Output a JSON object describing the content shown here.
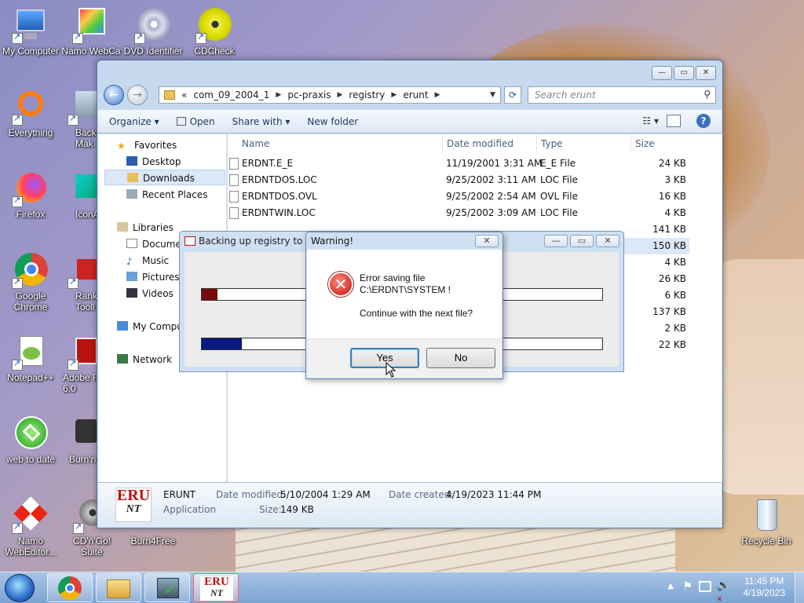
{
  "desktop": {
    "icons": [
      {
        "label": "My Computer"
      },
      {
        "label": "Namo WebCa"
      },
      {
        "label": "DVD Identifier"
      },
      {
        "label": "CDCheck"
      },
      {
        "label": "Everything"
      },
      {
        "label": "Back Mak"
      },
      {
        "label": "Firefox"
      },
      {
        "label": "IconA"
      },
      {
        "label": "Google Chrome"
      },
      {
        "label": "Rank Tooll"
      },
      {
        "label": "Notepad++"
      },
      {
        "label": "Adobe F 6.0"
      },
      {
        "label": "web to date"
      },
      {
        "label": "Burn'n"
      },
      {
        "label": "Namo WebEditor..."
      },
      {
        "label": "CD'n'Go! Suite"
      },
      {
        "label": "Burn4Free"
      },
      {
        "label": "Recycle Bin"
      }
    ]
  },
  "explorer": {
    "breadcrumb": [
      "«",
      "com_09_2004_1",
      "pc-praxis",
      "registry",
      "erunt"
    ],
    "search_placeholder": "Search erunt",
    "toolbar": {
      "organize": "Organize",
      "open": "Open",
      "share_with": "Share with",
      "new_folder": "New folder"
    },
    "nav": {
      "favorites": "Favorites",
      "desktop": "Desktop",
      "downloads": "Downloads",
      "recent_places": "Recent Places",
      "libraries": "Libraries",
      "documents": "Documen",
      "music": "Music",
      "pictures": "Pictures",
      "videos": "Videos",
      "my_computer": "My Compu",
      "network": "Network"
    },
    "columns": {
      "name": "Name",
      "date": "Date modified",
      "type": "Type",
      "size": "Size"
    },
    "files": [
      {
        "name": "ERDNT.E_E",
        "date": "11/19/2001 3:31 AM",
        "type": "E_E File",
        "size": "24 KB"
      },
      {
        "name": "ERDNTDOS.LOC",
        "date": "9/25/2002 3:11 AM",
        "type": "LOC File",
        "size": "3 KB"
      },
      {
        "name": "ERDNTDOS.OVL",
        "date": "9/25/2002 2:54 AM",
        "type": "OVL File",
        "size": "16 KB"
      },
      {
        "name": "ERDNTWIN.LOC",
        "date": "9/25/2002 3:09 AM",
        "type": "LOC File",
        "size": "4 KB"
      }
    ],
    "hidden_sizes": [
      "141 KB",
      "150 KB",
      "4 KB",
      "26 KB",
      "6 KB",
      "137 KB",
      "2 KB",
      "22 KB"
    ],
    "details": {
      "name": "ERUNT",
      "kind": "Application",
      "date_modified_label": "Date modified:",
      "date_modified": "5/10/2004 1:29 AM",
      "size_label": "Size:",
      "size": "149 KB",
      "date_created_label": "Date created:",
      "date_created": "4/19/2023 11:44 PM",
      "logo_top": "ERU",
      "logo_bottom": "NT"
    }
  },
  "backup_dialog": {
    "title": "Backing up registry to C:\\",
    "progress1": 0.04,
    "progress2": 0.1,
    "progress1_color": "#7a0a0a",
    "progress2_color": "#0a1a80"
  },
  "warning_dialog": {
    "title": "Warning!",
    "line1": "Error saving file",
    "line2": "C:\\ERDNT\\SYSTEM !",
    "line3": "Continue with the next file?",
    "yes": "Yes",
    "no": "No"
  },
  "taskbar": {
    "time": "11:45 PM",
    "date": "4/19/2023"
  }
}
